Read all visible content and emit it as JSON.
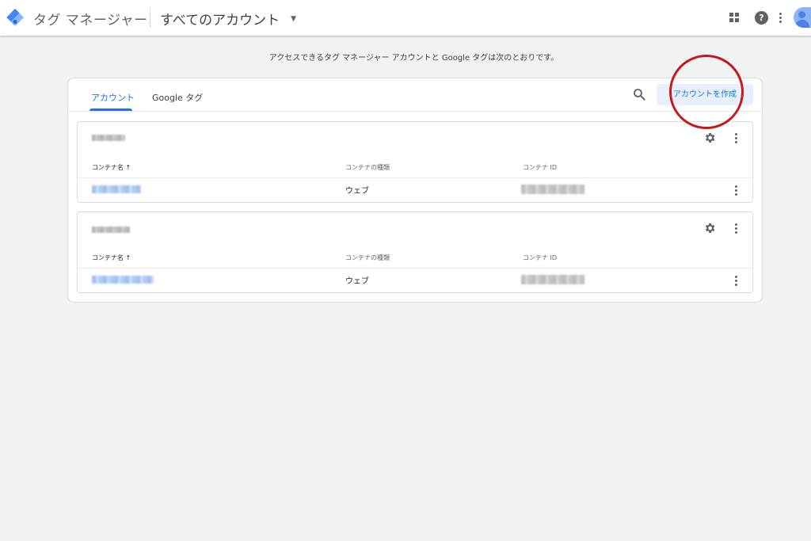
{
  "header": {
    "app_title": "タグ マネージャー",
    "account_selector": "すべてのアカウント",
    "logo_icon": "tag-manager-logo-icon",
    "icons": [
      "apps-icon",
      "help-icon",
      "more-vert-icon",
      "avatar"
    ]
  },
  "intro_text": "アクセスできるタグ マネージャー アカウントと Google タグは次のとおりです。",
  "tabs": [
    {
      "label": "アカウント",
      "active": true
    },
    {
      "label": "Google タグ",
      "active": false
    }
  ],
  "toolbar": {
    "create_account_label": "アカウントを作成",
    "search_icon": "search-icon"
  },
  "accounts": [
    {
      "columns": {
        "name": "コンテナ名 ↑",
        "type": "コンテナの種類",
        "id": "コンテナ ID"
      },
      "rows": [
        {
          "type": "ウェブ"
        }
      ]
    },
    {
      "columns": {
        "name": "コンテナ名 ↑",
        "type": "コンテナの種類",
        "id": "コンテナ ID"
      },
      "rows": [
        {
          "type": "ウェブ"
        }
      ]
    }
  ],
  "colors": {
    "accent": "#1a73e8",
    "accent_bg": "#e8f0fe",
    "page_bg": "#f1f2f4",
    "annotation_red": "#c5191c"
  }
}
